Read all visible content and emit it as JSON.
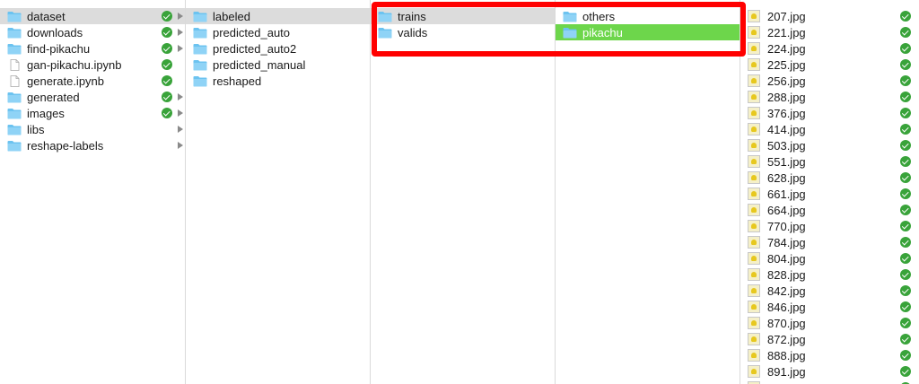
{
  "columns": [
    {
      "items": [
        {
          "name": "dataset",
          "kind": "folder",
          "checked": true,
          "chevron": true,
          "state": "parent"
        },
        {
          "name": "downloads",
          "kind": "folder",
          "checked": true,
          "chevron": true
        },
        {
          "name": "find-pikachu",
          "kind": "folder",
          "checked": true,
          "chevron": true
        },
        {
          "name": "gan-pikachu.ipynb",
          "kind": "file",
          "checked": true,
          "chevron": false
        },
        {
          "name": "generate.ipynb",
          "kind": "file",
          "checked": true,
          "chevron": false
        },
        {
          "name": "generated",
          "kind": "folder",
          "checked": true,
          "chevron": true
        },
        {
          "name": "images",
          "kind": "folder",
          "checked": true,
          "chevron": true
        },
        {
          "name": "libs",
          "kind": "folder",
          "checked": false,
          "chevron": true
        },
        {
          "name": "reshape-labels",
          "kind": "folder",
          "checked": false,
          "chevron": true
        }
      ]
    },
    {
      "items": [
        {
          "name": "labeled",
          "kind": "folder",
          "checked": true,
          "chevron": true,
          "state": "parent"
        },
        {
          "name": "predicted_auto",
          "kind": "folder",
          "checked": true,
          "chevron": true
        },
        {
          "name": "predicted_auto2",
          "kind": "folder",
          "checked": true,
          "chevron": true
        },
        {
          "name": "predicted_manual",
          "kind": "folder",
          "checked": true,
          "chevron": true
        },
        {
          "name": "reshaped",
          "kind": "folder",
          "checked": true,
          "chevron": true
        }
      ]
    },
    {
      "items": [
        {
          "name": "trains",
          "kind": "folder",
          "checked": true,
          "chevron": true,
          "state": "parent"
        },
        {
          "name": "valids",
          "kind": "folder",
          "checked": true,
          "chevron": true
        }
      ]
    },
    {
      "items": [
        {
          "name": "others",
          "kind": "folder",
          "checked": true,
          "chevron": true
        },
        {
          "name": "pikachu",
          "kind": "folder",
          "checked": true,
          "chevron": true,
          "state": "active"
        }
      ]
    },
    {
      "items": [
        {
          "name": "207.jpg",
          "kind": "image",
          "checked": true,
          "chevron": false
        },
        {
          "name": "221.jpg",
          "kind": "image",
          "checked": true,
          "chevron": false
        },
        {
          "name": "224.jpg",
          "kind": "image",
          "checked": true,
          "chevron": false
        },
        {
          "name": "225.jpg",
          "kind": "image",
          "checked": true,
          "chevron": false
        },
        {
          "name": "256.jpg",
          "kind": "image",
          "checked": true,
          "chevron": false
        },
        {
          "name": "288.jpg",
          "kind": "image",
          "checked": true,
          "chevron": false
        },
        {
          "name": "376.jpg",
          "kind": "image",
          "checked": true,
          "chevron": false
        },
        {
          "name": "414.jpg",
          "kind": "image",
          "checked": true,
          "chevron": false
        },
        {
          "name": "503.jpg",
          "kind": "image",
          "checked": true,
          "chevron": false
        },
        {
          "name": "551.jpg",
          "kind": "image",
          "checked": true,
          "chevron": false
        },
        {
          "name": "628.jpg",
          "kind": "image",
          "checked": true,
          "chevron": false
        },
        {
          "name": "661.jpg",
          "kind": "image",
          "checked": true,
          "chevron": false
        },
        {
          "name": "664.jpg",
          "kind": "image",
          "checked": true,
          "chevron": false
        },
        {
          "name": "770.jpg",
          "kind": "image",
          "checked": true,
          "chevron": false
        },
        {
          "name": "784.jpg",
          "kind": "image",
          "checked": true,
          "chevron": false
        },
        {
          "name": "804.jpg",
          "kind": "image",
          "checked": true,
          "chevron": false
        },
        {
          "name": "828.jpg",
          "kind": "image",
          "checked": true,
          "chevron": false
        },
        {
          "name": "842.jpg",
          "kind": "image",
          "checked": true,
          "chevron": false
        },
        {
          "name": "846.jpg",
          "kind": "image",
          "checked": true,
          "chevron": false
        },
        {
          "name": "870.jpg",
          "kind": "image",
          "checked": true,
          "chevron": false
        },
        {
          "name": "872.jpg",
          "kind": "image",
          "checked": true,
          "chevron": false
        },
        {
          "name": "888.jpg",
          "kind": "image",
          "checked": true,
          "chevron": false
        },
        {
          "name": "891.jpg",
          "kind": "image",
          "checked": true,
          "chevron": false
        },
        {
          "name": "",
          "kind": "image",
          "checked": true,
          "chevron": false
        }
      ]
    }
  ],
  "colors": {
    "selected_active": "#6dd64b",
    "selected_parent": "#dcdcdc",
    "synced_check": "#39a33a",
    "folder_blue": "#6cc3f0",
    "annotation_box": "#ff0000"
  },
  "icons": {
    "folder": "folder-icon",
    "file": "document-icon",
    "image": "image-thumbnail-icon",
    "status": "synced-check-icon",
    "expand": "chevron-right-icon"
  }
}
